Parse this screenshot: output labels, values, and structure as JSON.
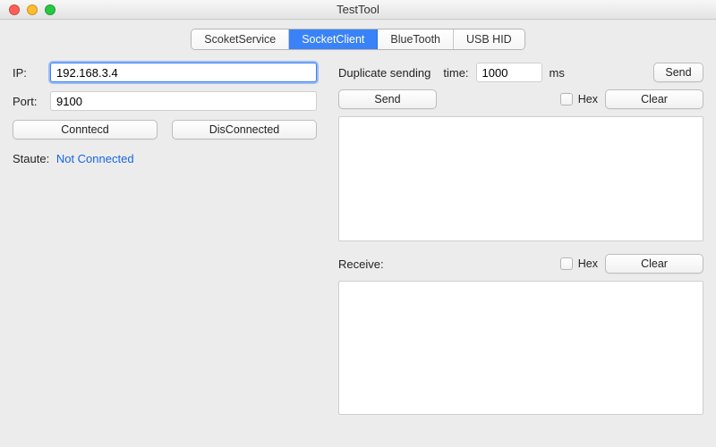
{
  "window": {
    "title": "TestTool"
  },
  "tabs": [
    {
      "label": "ScoketService",
      "active": false
    },
    {
      "label": "SocketClient",
      "active": true
    },
    {
      "label": "BlueTooth",
      "active": false
    },
    {
      "label": "USB HID",
      "active": false
    }
  ],
  "connection": {
    "ip_label": "IP:",
    "ip_value": "192.168.3.4",
    "port_label": "Port:",
    "port_value": "9100",
    "connect_btn": "Conntecd",
    "disconnect_btn": "DisConnected",
    "status_label": "Staute:",
    "status_value": "Not Connected"
  },
  "sending": {
    "dup_label": "Duplicate sending",
    "time_label": "time:",
    "time_value": "1000",
    "time_unit": "ms",
    "send_small_btn": "Send",
    "send_btn": "Send",
    "hex_label": "Hex",
    "clear_btn": "Clear"
  },
  "receive": {
    "label": "Receive:",
    "hex_label": "Hex",
    "clear_btn": "Clear"
  }
}
